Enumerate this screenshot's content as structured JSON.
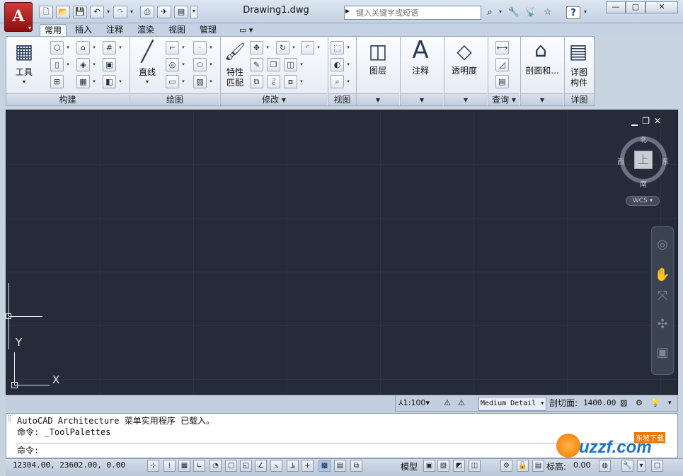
{
  "window": {
    "title": "Drawing1.dwg",
    "search_placeholder": "键入关键字或短语",
    "app_button": "A"
  },
  "tabs": [
    {
      "label": "常用",
      "active": true
    },
    {
      "label": "插入"
    },
    {
      "label": "注释"
    },
    {
      "label": "渲染"
    },
    {
      "label": "视图"
    },
    {
      "label": "管理"
    }
  ],
  "ribbon": {
    "panels": {
      "build": "构建",
      "draw": "绘图",
      "modify": "修改",
      "view": "视图",
      "query": "查询",
      "detail": "详图"
    },
    "tools_label": "工具",
    "line_label": "直线",
    "match_prop_label": "特性\n匹配",
    "layers_label": "图层",
    "annotate_label": "注释",
    "transparency_label": "透明度",
    "section_label": "剖面和...",
    "detail_component_label": "详图\n构件"
  },
  "viewcube": {
    "north": "北",
    "south": "南",
    "east": "东",
    "west": "西",
    "top": "上",
    "wcs": "WCS"
  },
  "ucs": {
    "y": "Y",
    "x": "X"
  },
  "annotation_bar": {
    "scale": "1:100",
    "detail": "Medium Detail",
    "cut_plane_label": "剖切面:",
    "cut_plane_value": "1400.00"
  },
  "command": {
    "lines": [
      "AutoCAD Architecture 菜单实用程序 已载入。",
      "命令: _ToolPalettes"
    ],
    "prompt": "命令:"
  },
  "status": {
    "coords": "12304.00, 23602.00, 0.00",
    "model": "模型",
    "elev_label": "标高:",
    "elev_value": "0.00"
  },
  "watermark": {
    "text": "uzzf.com",
    "sub": "东坡下载"
  }
}
